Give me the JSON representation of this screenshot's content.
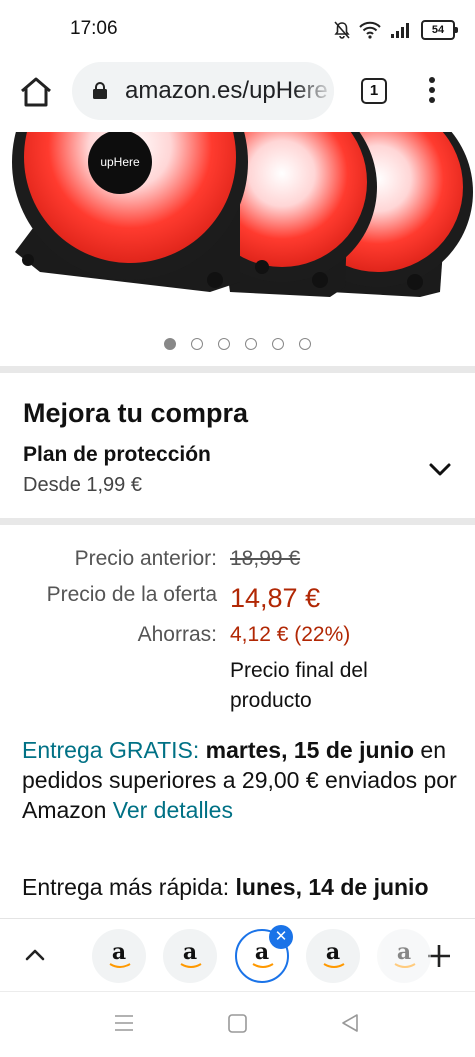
{
  "status_bar": {
    "time": "17:06",
    "battery": "54",
    "icons": [
      "bell-off-icon",
      "wifi-icon",
      "signal-icon",
      "battery-icon"
    ]
  },
  "browser": {
    "url": "amazon.es/upHere",
    "tab_count": "1",
    "icons": [
      "home-icon",
      "lock-icon",
      "more-vert-icon"
    ]
  },
  "product": {
    "brand_logo": "upHere",
    "image_count": 6,
    "active_image_index": 0
  },
  "upgrade": {
    "title": "Mejora tu compra",
    "plan_title": "Plan de protección",
    "plan_subtitle": "Desde 1,99 €"
  },
  "pricing": {
    "previous_label": "Precio anterior:",
    "previous_price": "18,99 €",
    "deal_label": "Precio de la oferta",
    "deal_price": "14,87 €",
    "savings_label": "Ahorras:",
    "savings_value": "4,12 € (22%)",
    "final_note": "Precio final del producto"
  },
  "delivery": {
    "free_label": "Entrega GRATIS:",
    "free_date": "martes, 15 de junio",
    "free_text": "en pedidos superiores a 29,00 € enviados por Amazon",
    "details_link": "Ver detalles",
    "fast_label": "Entrega más rápida:",
    "fast_date": "lunes, 14 de junio"
  },
  "tab_strip": {
    "tabs": [
      {
        "label": "a"
      },
      {
        "label": "a"
      },
      {
        "label": "a"
      },
      {
        "label": "a"
      },
      {
        "label": "a"
      }
    ],
    "selected_index": 2
  },
  "colors": {
    "accent_red": "#b12704",
    "link_teal": "#007185",
    "chrome_blue": "#1a73e8"
  }
}
